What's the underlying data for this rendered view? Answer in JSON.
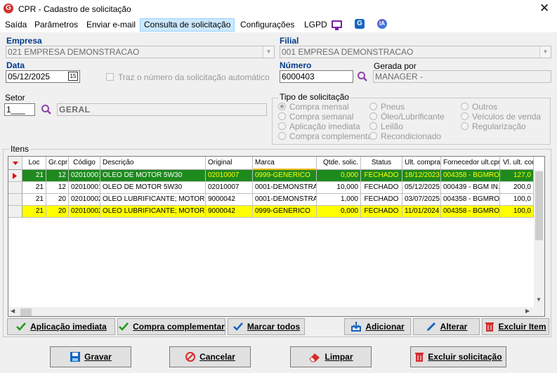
{
  "window": {
    "title": "CPR - Cadastro de solicitação",
    "logo": "G"
  },
  "menu": [
    {
      "label": "Saída"
    },
    {
      "label": "Parâmetros"
    },
    {
      "label": "Enviar e-mail"
    },
    {
      "label": "Consulta de solicitação",
      "active": true
    },
    {
      "label": "Configurações"
    },
    {
      "label": "LGPD"
    }
  ],
  "menu_icons": [
    "monitor-icon",
    "g-app-icon",
    "ia-icon"
  ],
  "ia_icon_text": "IA",
  "g_icon_text": "G",
  "empresa": {
    "label": "Empresa",
    "value": "021 EMPRESA DEMONSTRACAO"
  },
  "filial": {
    "label": "Filial",
    "value": "001 EMPRESA DEMONSTRACAO"
  },
  "data": {
    "label": "Data",
    "value": "05/12/2025",
    "cal": "15"
  },
  "auto_numero": {
    "label": "Traz o número da solicitação automático"
  },
  "numero": {
    "label": "Número",
    "value": "6000403"
  },
  "gerada_por": {
    "label": "Gerada por",
    "value": "MANAGER -"
  },
  "setor": {
    "label": "Setor",
    "code": "1___",
    "name": "GERAL"
  },
  "tipo": {
    "legend": "Tipo de solicitação",
    "options": [
      "Compra mensal",
      "Compra semanal",
      "Aplicação imediata",
      "Compra complementar",
      "Pneus",
      "Óleo/Lubrificante",
      "Leilão",
      "Recondicionado",
      "Outros",
      "Veículos de venda",
      "Regularização"
    ],
    "selected": "Compra mensal"
  },
  "itens": {
    "legend": "Itens",
    "columns": [
      "Loc",
      "Gr.cpr",
      "Código",
      "Descrição",
      "Original",
      "Marca",
      "Qtde. solic.",
      "Status",
      "Ult. compra",
      "Fornecedor ult.cpr",
      "Vl. ult. com"
    ],
    "rows": [
      {
        "loc": "21",
        "grcpr": "12",
        "codigo": "02010001",
        "descricao": "OLEO DE MOTOR 5W30",
        "original": "02010007",
        "marca": "0999-GENERICO",
        "qtde": "0,000",
        "status": "FECHADO",
        "ult": "18/12/2023",
        "forn": "004358 - BGMRO...",
        "vl": "127,0",
        "style": "green"
      },
      {
        "loc": "21",
        "grcpr": "12",
        "codigo": "02010001",
        "descricao": "OLEO DE MOTOR 5W30",
        "original": "02010007",
        "marca": "0001-DEMONSTRA...",
        "qtde": "10,000",
        "status": "FECHADO",
        "ult": "05/12/2025",
        "forn": "000439 - BGM IN...",
        "vl": "200,0",
        "style": "white"
      },
      {
        "loc": "21",
        "grcpr": "20",
        "codigo": "02010002",
        "descricao": "OLEO LUBRIFICANTE; MOTOR; L...",
        "original": "9000042",
        "marca": "0001-DEMONSTRA...",
        "qtde": "1,000",
        "status": "FECHADO",
        "ult": "03/07/2025",
        "forn": "004358 - BGMRO...",
        "vl": "100,0",
        "style": "white"
      },
      {
        "loc": "21",
        "grcpr": "20",
        "codigo": "02010002",
        "descricao": "OLEO LUBRIFICANTE; MOTOR; L...",
        "original": "9000042",
        "marca": "0999-GENERICO",
        "qtde": "0,000",
        "status": "FECHADO",
        "ult": "11/01/2024",
        "forn": "004358 - BGMRO...",
        "vl": "100,0",
        "style": "yellow"
      }
    ]
  },
  "buttons": {
    "aplicacao": "Aplicação imediata",
    "complementar": "Compra complementar",
    "marcar": "Marcar todos",
    "adicionar": "Adicionar",
    "alterar": "Alterar",
    "excluir_item": "Excluir Item",
    "gravar": "Gravar",
    "cancelar": "Cancelar",
    "limpar": "Limpar",
    "excluir_solicitacao": "Excluir solicitação"
  },
  "colors": {
    "green_row": "#1e8a1e",
    "yellow_row": "#ffff00",
    "label_blue": "#003a8c",
    "menu_active": "#cce8ff",
    "monitor_icon": "#7b1fa2",
    "g_icon": "#1565c0"
  }
}
